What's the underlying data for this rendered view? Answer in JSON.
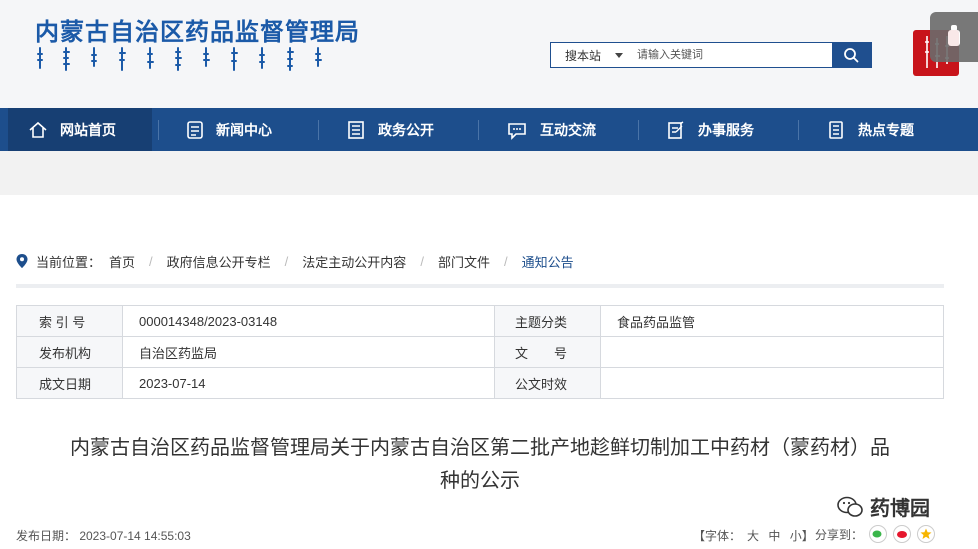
{
  "header": {
    "site_title": "内蒙古自治区药品监督管理局",
    "search": {
      "scope": "搜本站",
      "placeholder": "请输入关键词"
    }
  },
  "nav": {
    "items": [
      {
        "label": "网站首页",
        "icon": "home-icon"
      },
      {
        "label": "新闻中心",
        "icon": "news-icon"
      },
      {
        "label": "政务公开",
        "icon": "document-icon"
      },
      {
        "label": "互动交流",
        "icon": "chat-icon"
      },
      {
        "label": "办事服务",
        "icon": "service-icon"
      },
      {
        "label": "热点专题",
        "icon": "topic-icon"
      }
    ]
  },
  "breadcrumb": {
    "prefix": "当前位置：",
    "items": [
      "首页",
      "政府信息公开专栏",
      "法定主动公开内容",
      "部门文件",
      "通知公告"
    ]
  },
  "info_table": {
    "index_label": "索 引 号",
    "index_value": "000014348/2023-03148",
    "category_label": "主题分类",
    "category_value": "食品药品监管",
    "publisher_label": "发布机构",
    "publisher_value": "自治区药监局",
    "docno_label": "文　　号",
    "docno_value": "",
    "date_label": "成文日期",
    "date_value": "2023-07-14",
    "pubdate_label": "公文时效",
    "pubdate_value": ""
  },
  "article": {
    "title_line1": "内蒙古自治区药品监督管理局关于内蒙古自治区第二批产地趁鲜切制加工中药材（蒙药材）品",
    "title_line2": "种的公示"
  },
  "meta": {
    "publish": "发布日期： 2023-07-14 14:55:03",
    "font_label": "【字体：",
    "font_large": "大",
    "font_medium": "中",
    "font_small": "小】",
    "share_label": "分享到："
  },
  "watermark": {
    "text": "药博园"
  },
  "colors": {
    "brand_blue": "#1d4e8c",
    "seal_red": "#c8141b"
  }
}
